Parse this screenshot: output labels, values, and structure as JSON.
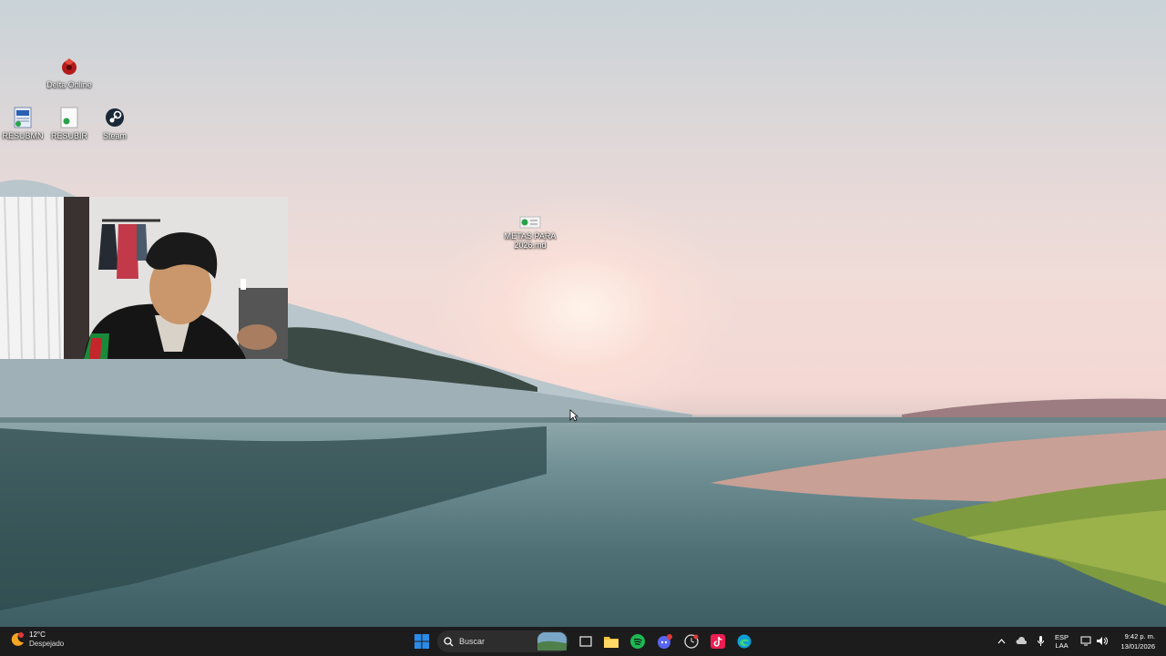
{
  "desktop": {
    "icons": [
      {
        "label": "Delta Online",
        "icon": "delta-online-app-icon"
      },
      {
        "label": "RESUBMN",
        "icon": "document-file-icon"
      },
      {
        "label": "RESUBIR",
        "icon": "blank-document-icon"
      },
      {
        "label": "Steam",
        "icon": "steam-icon"
      },
      {
        "label": "METAS PARA 2026.md",
        "icon": "markdown-file-icon"
      }
    ]
  },
  "taskbar": {
    "weather": {
      "temp": "12°C",
      "condition": "Despejado",
      "icon": "weather-moon-icon"
    },
    "start_icon": "windows-start-icon",
    "search_placeholder": "Buscar",
    "apps": [
      "widgets-landscape-icon",
      "task-view-icon",
      "file-explorer-icon",
      "spotify-icon",
      "discord-icon",
      "clock-app-icon",
      "tiktok-icon",
      "edge-icon"
    ],
    "tray": {
      "language": "ESP",
      "layout": "LAA",
      "time": "9:42 p. m.",
      "date": "13/01/2026"
    }
  },
  "colors": {
    "taskbar_bg": "#1c1c1c",
    "windows_blue": "#2b8be8",
    "spotify_green": "#1db954",
    "discord_blurple": "#5865f2",
    "tiktok_pink": "#ee1d52"
  }
}
